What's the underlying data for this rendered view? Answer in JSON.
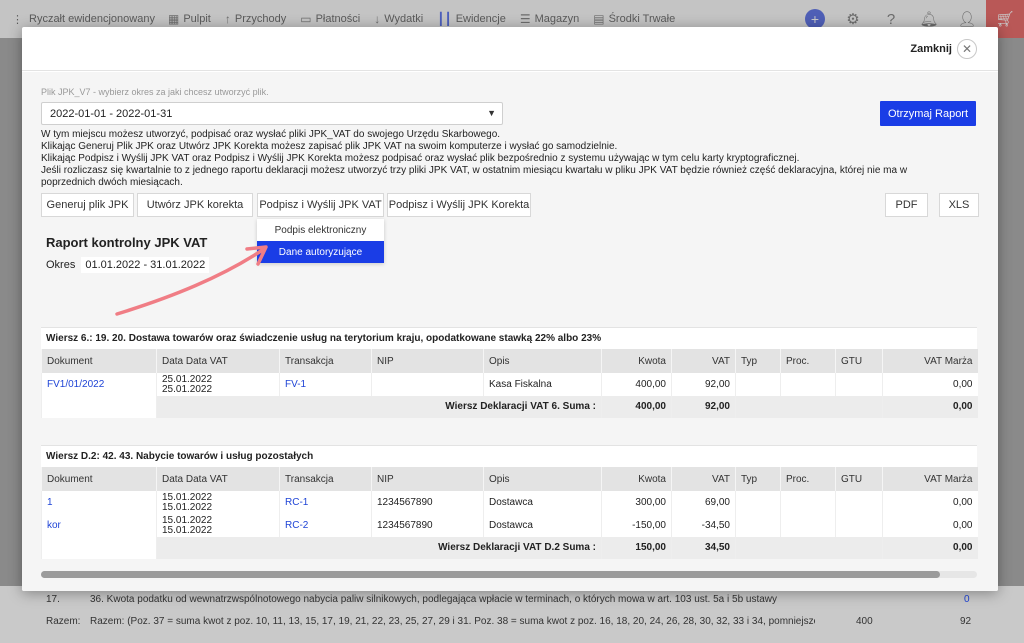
{
  "app": {
    "title": "Ryczałt ewidencjonowany",
    "nav": [
      {
        "label": "Pulpit",
        "icon": "grid-icon"
      },
      {
        "label": "Przychody",
        "icon": "arrow-up-icon"
      },
      {
        "label": "Płatności",
        "icon": "card-icon"
      },
      {
        "label": "Wydatki",
        "icon": "arrow-down-icon"
      },
      {
        "label": "Ewidencje",
        "icon": "bars-icon"
      },
      {
        "label": "Magazyn",
        "icon": "warehouse-icon"
      },
      {
        "label": "Środki Trwałe",
        "icon": "assets-icon"
      }
    ],
    "accent": "#1a3de6",
    "cart_color": "#e0312f"
  },
  "background_rows": [
    {
      "num": "17.",
      "text": "36. Kwota podatku od wewnatrzwspólnotowego nabycia paliw silnikowych, podlegająca wpłacie w terminach, o których mowa w art. 103 ust. 5a i 5b ustawy",
      "v1": "",
      "v2": "0"
    },
    {
      "num": "Razem:",
      "text": "Razem: (Poz. 37 = suma kwot z poz. 10, 11, 13, 15, 17, 19, 21, 22, 23, 25, 27, 29 i 31. Poz. 38 = suma kwot z poz. 16, 18, 20, 24, 26, 28, 30, 32, 33 i 34, pomniejszo...",
      "v1": "400",
      "v2": "92"
    }
  ],
  "modal": {
    "close_label": "Zamknij",
    "help_label": "Plik JPK_V7 - wybierz okres za jaki chcesz utworzyć plik.",
    "period_value": "2022-01-01 - 2022-01-31",
    "report_button": "Otrzymaj Raport",
    "info_lines": [
      "W tym miejscu możesz utworzyć, podpisać oraz wysłać pliki JPK_VAT do swojego Urzędu Skarbowego.",
      "Klikając Generuj Plik JPK oraz Utwórz JPK Korekta możesz zapisać plik JPK VAT na swoim komputerze i wysłać go samodzielnie.",
      "Klikając Podpisz i Wyślij JPK VAT oraz Podpisz i Wyślij JPK Korekta możesz podpisać oraz wysłać plik bezpośrednio z systemu używając w tym celu karty kryptograficznej.",
      "Jeśli rozliczasz się kwartalnie to z jednego raportu deklaracji możesz utworzyć trzy pliki JPK VAT, w ostatnim miesiącu kwartału w pliku JPK VAT będzie również część deklaracyjna, której nie ma w poprzednich dwóch miesiącach."
    ],
    "buttons": {
      "generate": "Generuj plik JPK",
      "correction": "Utwórz JPK korekta",
      "sign_send": "Podpisz i Wyślij JPK VAT",
      "sign_send_correction": "Podpisz i Wyślij JPK Korekta",
      "pdf": "PDF",
      "xls": "XLS"
    },
    "dropdown": [
      "Podpis elektroniczny",
      "Dane autoryzujące"
    ],
    "report_title": "Raport kontrolny JPK VAT",
    "period_label": "Okres",
    "period_range": "01.01.2022 - 31.01.2022",
    "columns": [
      "Dokument",
      "Data Data VAT",
      "Transakcja",
      "NIP",
      "Opis",
      "Kwota",
      "VAT",
      "Typ",
      "Proc.",
      "GTU",
      "VAT Marża"
    ],
    "sections": [
      {
        "title": "Wiersz 6.: 19. 20. Dostawa towarów oraz świadczenie usług na terytorium kraju, opodatkowane stawką 22% albo 23%",
        "rows": [
          {
            "doc": "FV1/01/2022",
            "date1": "25.01.2022",
            "date2": "25.01.2022",
            "trans": "FV-1",
            "nip": "",
            "desc": "Kasa Fiskalna",
            "amount": "400,00",
            "vat": "92,00",
            "type": "",
            "proc": "",
            "gtu": "",
            "margin": "0,00"
          }
        ],
        "sum_label": "Wiersz Deklaracji VAT 6. Suma :",
        "sum_amount": "400,00",
        "sum_vat": "92,00",
        "sum_margin": "0,00"
      },
      {
        "title": "Wiersz D.2: 42. 43. Nabycie towarów i usług pozostałych",
        "rows": [
          {
            "doc": "1",
            "date1": "15.01.2022",
            "date2": "15.01.2022",
            "trans": "RC-1",
            "nip": "1234567890",
            "desc": "Dostawca",
            "amount": "300,00",
            "vat": "69,00",
            "type": "",
            "proc": "",
            "gtu": "",
            "margin": "0,00"
          },
          {
            "doc": "kor",
            "date1": "15.01.2022",
            "date2": "15.01.2022",
            "trans": "RC-2",
            "nip": "1234567890",
            "desc": "Dostawca",
            "amount": "-150,00",
            "vat": "-34,50",
            "type": "",
            "proc": "",
            "gtu": "",
            "margin": "0,00"
          }
        ],
        "sum_label": "Wiersz Deklaracji VAT D.2 Suma :",
        "sum_amount": "150,00",
        "sum_vat": "34,50",
        "sum_margin": "0,00"
      }
    ],
    "scroll_progress": 0.96
  },
  "annotation": {
    "color": "#f07d85"
  }
}
